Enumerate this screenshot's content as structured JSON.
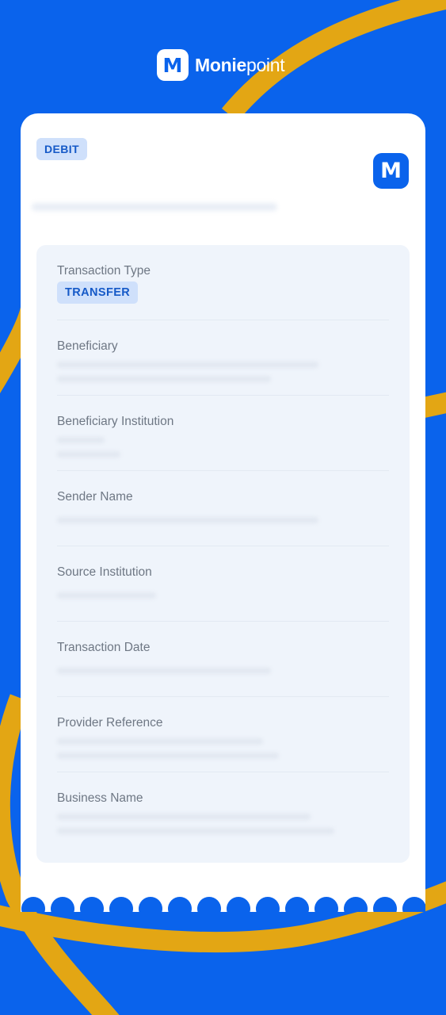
{
  "brand": {
    "mark": "M",
    "name_bold": "Monie",
    "name_light": "point"
  },
  "receipt": {
    "direction_badge": "DEBIT",
    "corner_logo_mark": "M"
  },
  "fields": [
    {
      "label": "Transaction Type",
      "value": "TRANSFER"
    },
    {
      "label": "Beneficiary"
    },
    {
      "label": "Beneficiary Institution"
    },
    {
      "label": "Sender Name"
    },
    {
      "label": "Source Institution"
    },
    {
      "label": "Transaction Date"
    },
    {
      "label": "Provider Reference"
    },
    {
      "label": "Business Name"
    }
  ],
  "colors": {
    "background": "#0a63ec",
    "accent_swoosh": "#e3a614",
    "badge_bg": "#cfe0fb",
    "badge_text": "#1559c7",
    "details_bg": "#eff4fb",
    "label_text": "#6e7784"
  }
}
